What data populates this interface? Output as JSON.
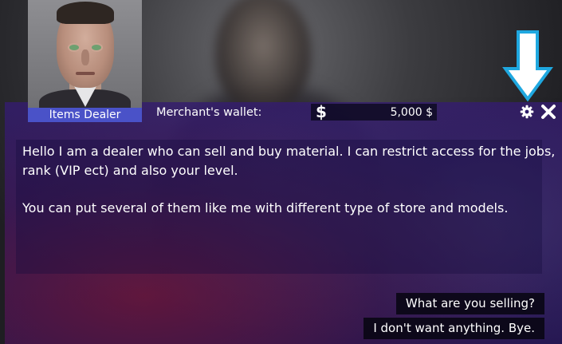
{
  "npc": {
    "name": "Items Dealer"
  },
  "wallet": {
    "label": "Merchant's wallet:",
    "currency_symbol": "$",
    "value": "5,000 $"
  },
  "header_icons": {
    "settings": "gear-icon",
    "close": "close-icon",
    "pointer": "down-arrow-icon",
    "pointer_color": "#1fa8e0"
  },
  "dialog": {
    "paragraphs": [
      "Hello I am a dealer who can sell and buy material. I can restrict access for the jobs, rank (VIP ect) and also your level.",
      "You can put several of them like me with different type of store and models."
    ]
  },
  "responses": [
    {
      "label": "What are you selling?"
    },
    {
      "label": "I don't want anything. Bye."
    }
  ],
  "colors": {
    "panel": "#2e1c6a",
    "name_label": "#4a52c8",
    "response_bg": "#08060f"
  }
}
